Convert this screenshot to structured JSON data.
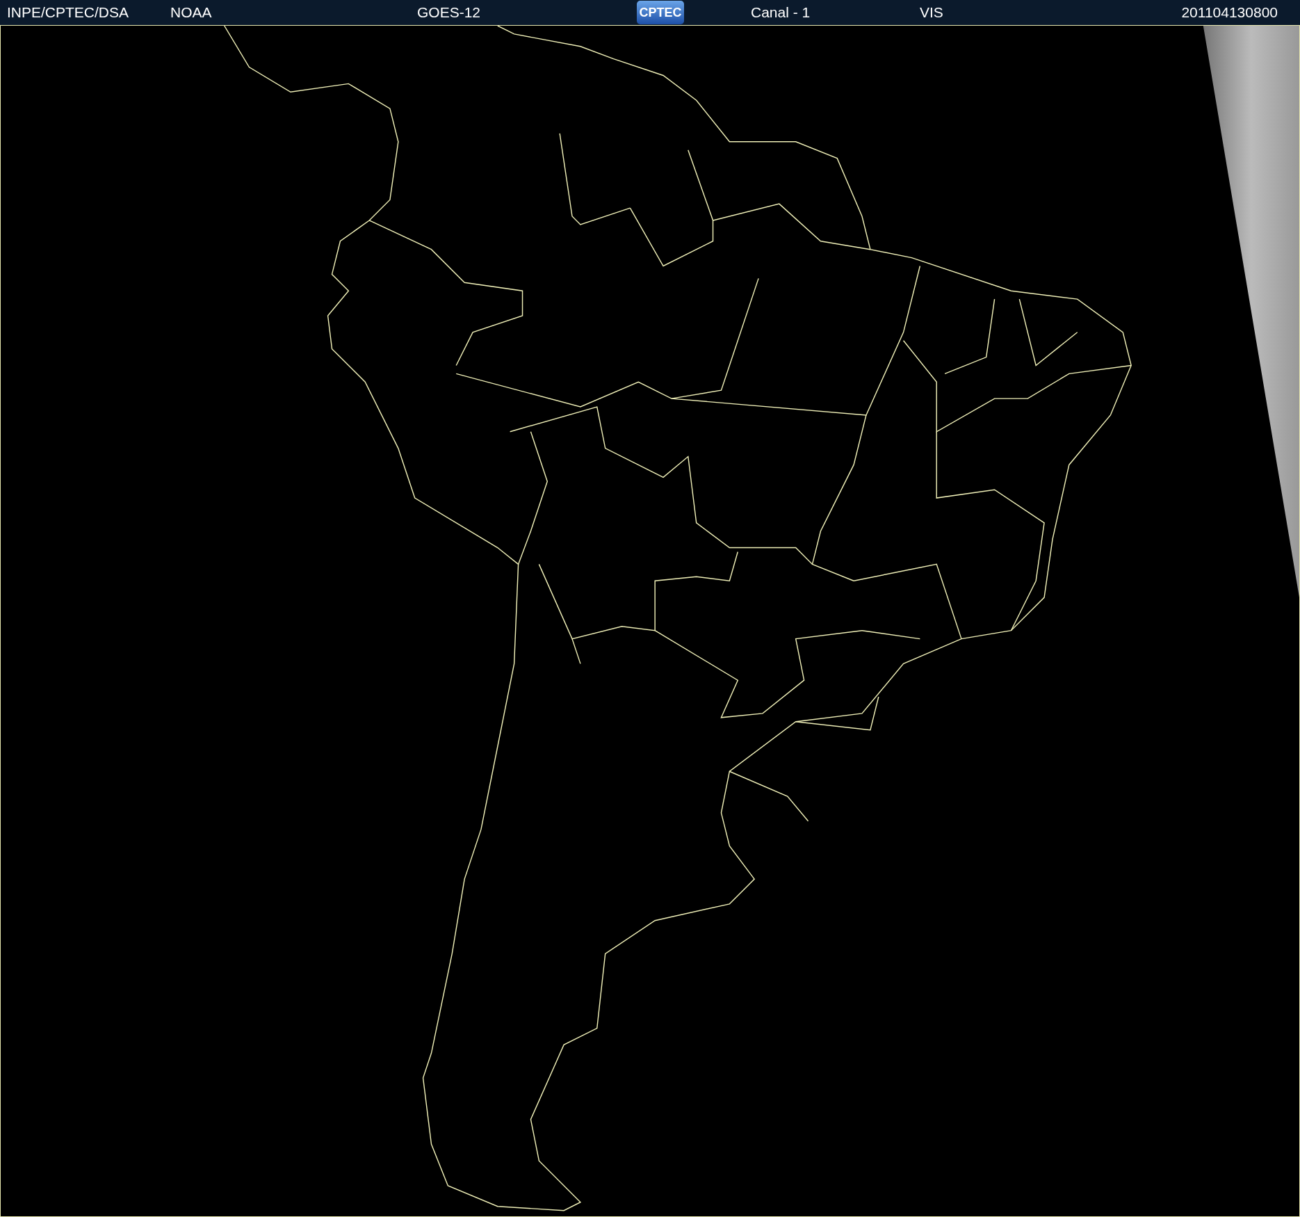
{
  "header": {
    "items": [
      "INPE/CPTEC/DSA",
      "NOAA",
      "GOES-12"
    ],
    "logo": "CPTEC",
    "channel": "Canal - 1",
    "band": "VIS",
    "timestamp": "201104130800"
  }
}
